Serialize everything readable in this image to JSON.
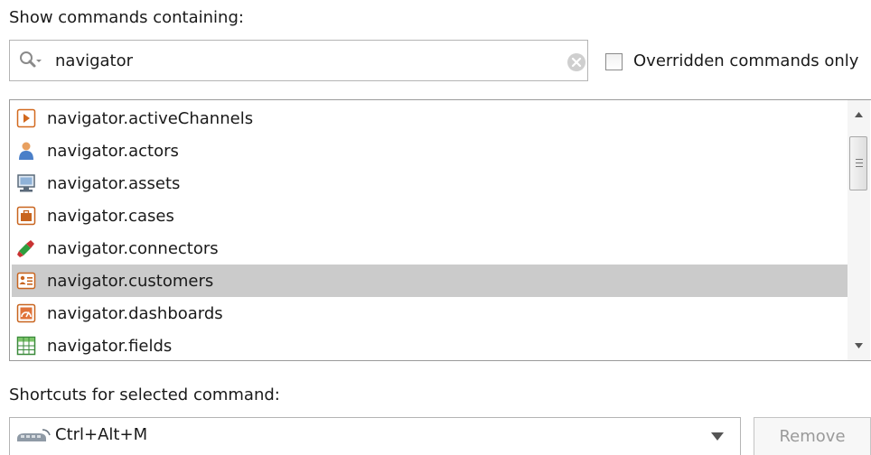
{
  "filter": {
    "label": "Show commands containing:",
    "query": "navigator",
    "overridden_label": "Overridden commands only",
    "overridden_checked": false
  },
  "commands": {
    "items": [
      {
        "label": "navigator.activeChannels",
        "icon": "play-channel-icon"
      },
      {
        "label": "navigator.actors",
        "icon": "person-icon"
      },
      {
        "label": "navigator.assets",
        "icon": "computer-icon"
      },
      {
        "label": "navigator.cases",
        "icon": "briefcase-icon"
      },
      {
        "label": "navigator.connectors",
        "icon": "connector-plug-icon"
      },
      {
        "label": "navigator.customers",
        "icon": "contact-card-icon",
        "selected": true
      },
      {
        "label": "navigator.dashboards",
        "icon": "dashboard-icon"
      },
      {
        "label": "navigator.fields",
        "icon": "table-grid-icon"
      }
    ]
  },
  "shortcut": {
    "label": "Shortcuts for selected command:",
    "value": "Ctrl+Alt+M",
    "icon": "keyboard-shortcut-icon",
    "remove_label": "Remove"
  },
  "colors": {
    "selection": "#cbcbcb",
    "border": "#b4b4b4",
    "disabled_text": "#9a9a9a"
  }
}
